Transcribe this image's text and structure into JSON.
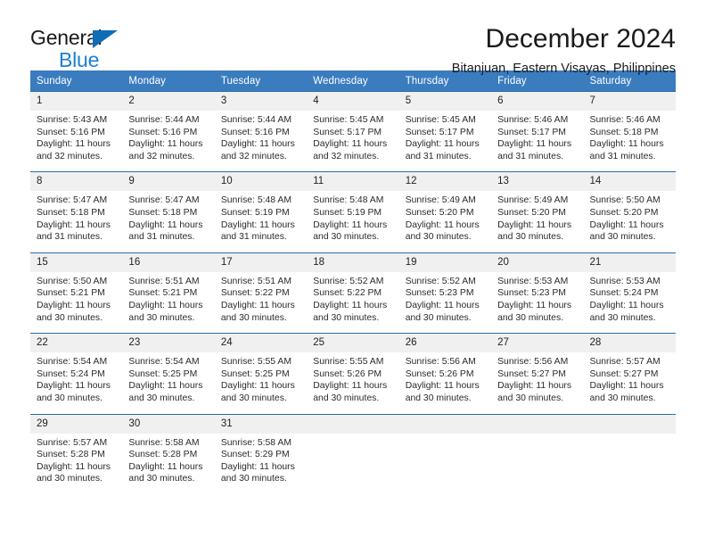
{
  "branding": {
    "name_part1": "General",
    "name_part2": "Blue",
    "triangle_color": "#0f6cb5"
  },
  "header": {
    "title": "December 2024",
    "subtitle": "Bitanjuan, Eastern Visayas, Philippines"
  },
  "theme": {
    "header_blue": "#3b7cbf",
    "row_rule_blue": "#2b6ca8",
    "daynum_background": "#f0f0f0"
  },
  "calendar": {
    "weekday_headers": [
      "Sunday",
      "Monday",
      "Tuesday",
      "Wednesday",
      "Thursday",
      "Friday",
      "Saturday"
    ],
    "weeks": [
      [
        {
          "day": "1",
          "sunrise": "Sunrise: 5:43 AM",
          "sunset": "Sunset: 5:16 PM",
          "daylight": "Daylight: 11 hours and 32 minutes."
        },
        {
          "day": "2",
          "sunrise": "Sunrise: 5:44 AM",
          "sunset": "Sunset: 5:16 PM",
          "daylight": "Daylight: 11 hours and 32 minutes."
        },
        {
          "day": "3",
          "sunrise": "Sunrise: 5:44 AM",
          "sunset": "Sunset: 5:16 PM",
          "daylight": "Daylight: 11 hours and 32 minutes."
        },
        {
          "day": "4",
          "sunrise": "Sunrise: 5:45 AM",
          "sunset": "Sunset: 5:17 PM",
          "daylight": "Daylight: 11 hours and 32 minutes."
        },
        {
          "day": "5",
          "sunrise": "Sunrise: 5:45 AM",
          "sunset": "Sunset: 5:17 PM",
          "daylight": "Daylight: 11 hours and 31 minutes."
        },
        {
          "day": "6",
          "sunrise": "Sunrise: 5:46 AM",
          "sunset": "Sunset: 5:17 PM",
          "daylight": "Daylight: 11 hours and 31 minutes."
        },
        {
          "day": "7",
          "sunrise": "Sunrise: 5:46 AM",
          "sunset": "Sunset: 5:18 PM",
          "daylight": "Daylight: 11 hours and 31 minutes."
        }
      ],
      [
        {
          "day": "8",
          "sunrise": "Sunrise: 5:47 AM",
          "sunset": "Sunset: 5:18 PM",
          "daylight": "Daylight: 11 hours and 31 minutes."
        },
        {
          "day": "9",
          "sunrise": "Sunrise: 5:47 AM",
          "sunset": "Sunset: 5:18 PM",
          "daylight": "Daylight: 11 hours and 31 minutes."
        },
        {
          "day": "10",
          "sunrise": "Sunrise: 5:48 AM",
          "sunset": "Sunset: 5:19 PM",
          "daylight": "Daylight: 11 hours and 31 minutes."
        },
        {
          "day": "11",
          "sunrise": "Sunrise: 5:48 AM",
          "sunset": "Sunset: 5:19 PM",
          "daylight": "Daylight: 11 hours and 30 minutes."
        },
        {
          "day": "12",
          "sunrise": "Sunrise: 5:49 AM",
          "sunset": "Sunset: 5:20 PM",
          "daylight": "Daylight: 11 hours and 30 minutes."
        },
        {
          "day": "13",
          "sunrise": "Sunrise: 5:49 AM",
          "sunset": "Sunset: 5:20 PM",
          "daylight": "Daylight: 11 hours and 30 minutes."
        },
        {
          "day": "14",
          "sunrise": "Sunrise: 5:50 AM",
          "sunset": "Sunset: 5:20 PM",
          "daylight": "Daylight: 11 hours and 30 minutes."
        }
      ],
      [
        {
          "day": "15",
          "sunrise": "Sunrise: 5:50 AM",
          "sunset": "Sunset: 5:21 PM",
          "daylight": "Daylight: 11 hours and 30 minutes."
        },
        {
          "day": "16",
          "sunrise": "Sunrise: 5:51 AM",
          "sunset": "Sunset: 5:21 PM",
          "daylight": "Daylight: 11 hours and 30 minutes."
        },
        {
          "day": "17",
          "sunrise": "Sunrise: 5:51 AM",
          "sunset": "Sunset: 5:22 PM",
          "daylight": "Daylight: 11 hours and 30 minutes."
        },
        {
          "day": "18",
          "sunrise": "Sunrise: 5:52 AM",
          "sunset": "Sunset: 5:22 PM",
          "daylight": "Daylight: 11 hours and 30 minutes."
        },
        {
          "day": "19",
          "sunrise": "Sunrise: 5:52 AM",
          "sunset": "Sunset: 5:23 PM",
          "daylight": "Daylight: 11 hours and 30 minutes."
        },
        {
          "day": "20",
          "sunrise": "Sunrise: 5:53 AM",
          "sunset": "Sunset: 5:23 PM",
          "daylight": "Daylight: 11 hours and 30 minutes."
        },
        {
          "day": "21",
          "sunrise": "Sunrise: 5:53 AM",
          "sunset": "Sunset: 5:24 PM",
          "daylight": "Daylight: 11 hours and 30 minutes."
        }
      ],
      [
        {
          "day": "22",
          "sunrise": "Sunrise: 5:54 AM",
          "sunset": "Sunset: 5:24 PM",
          "daylight": "Daylight: 11 hours and 30 minutes."
        },
        {
          "day": "23",
          "sunrise": "Sunrise: 5:54 AM",
          "sunset": "Sunset: 5:25 PM",
          "daylight": "Daylight: 11 hours and 30 minutes."
        },
        {
          "day": "24",
          "sunrise": "Sunrise: 5:55 AM",
          "sunset": "Sunset: 5:25 PM",
          "daylight": "Daylight: 11 hours and 30 minutes."
        },
        {
          "day": "25",
          "sunrise": "Sunrise: 5:55 AM",
          "sunset": "Sunset: 5:26 PM",
          "daylight": "Daylight: 11 hours and 30 minutes."
        },
        {
          "day": "26",
          "sunrise": "Sunrise: 5:56 AM",
          "sunset": "Sunset: 5:26 PM",
          "daylight": "Daylight: 11 hours and 30 minutes."
        },
        {
          "day": "27",
          "sunrise": "Sunrise: 5:56 AM",
          "sunset": "Sunset: 5:27 PM",
          "daylight": "Daylight: 11 hours and 30 minutes."
        },
        {
          "day": "28",
          "sunrise": "Sunrise: 5:57 AM",
          "sunset": "Sunset: 5:27 PM",
          "daylight": "Daylight: 11 hours and 30 minutes."
        }
      ],
      [
        {
          "day": "29",
          "sunrise": "Sunrise: 5:57 AM",
          "sunset": "Sunset: 5:28 PM",
          "daylight": "Daylight: 11 hours and 30 minutes."
        },
        {
          "day": "30",
          "sunrise": "Sunrise: 5:58 AM",
          "sunset": "Sunset: 5:28 PM",
          "daylight": "Daylight: 11 hours and 30 minutes."
        },
        {
          "day": "31",
          "sunrise": "Sunrise: 5:58 AM",
          "sunset": "Sunset: 5:29 PM",
          "daylight": "Daylight: 11 hours and 30 minutes."
        },
        {
          "day": "",
          "sunrise": "",
          "sunset": "",
          "daylight": ""
        },
        {
          "day": "",
          "sunrise": "",
          "sunset": "",
          "daylight": ""
        },
        {
          "day": "",
          "sunrise": "",
          "sunset": "",
          "daylight": ""
        },
        {
          "day": "",
          "sunrise": "",
          "sunset": "",
          "daylight": ""
        }
      ]
    ]
  }
}
